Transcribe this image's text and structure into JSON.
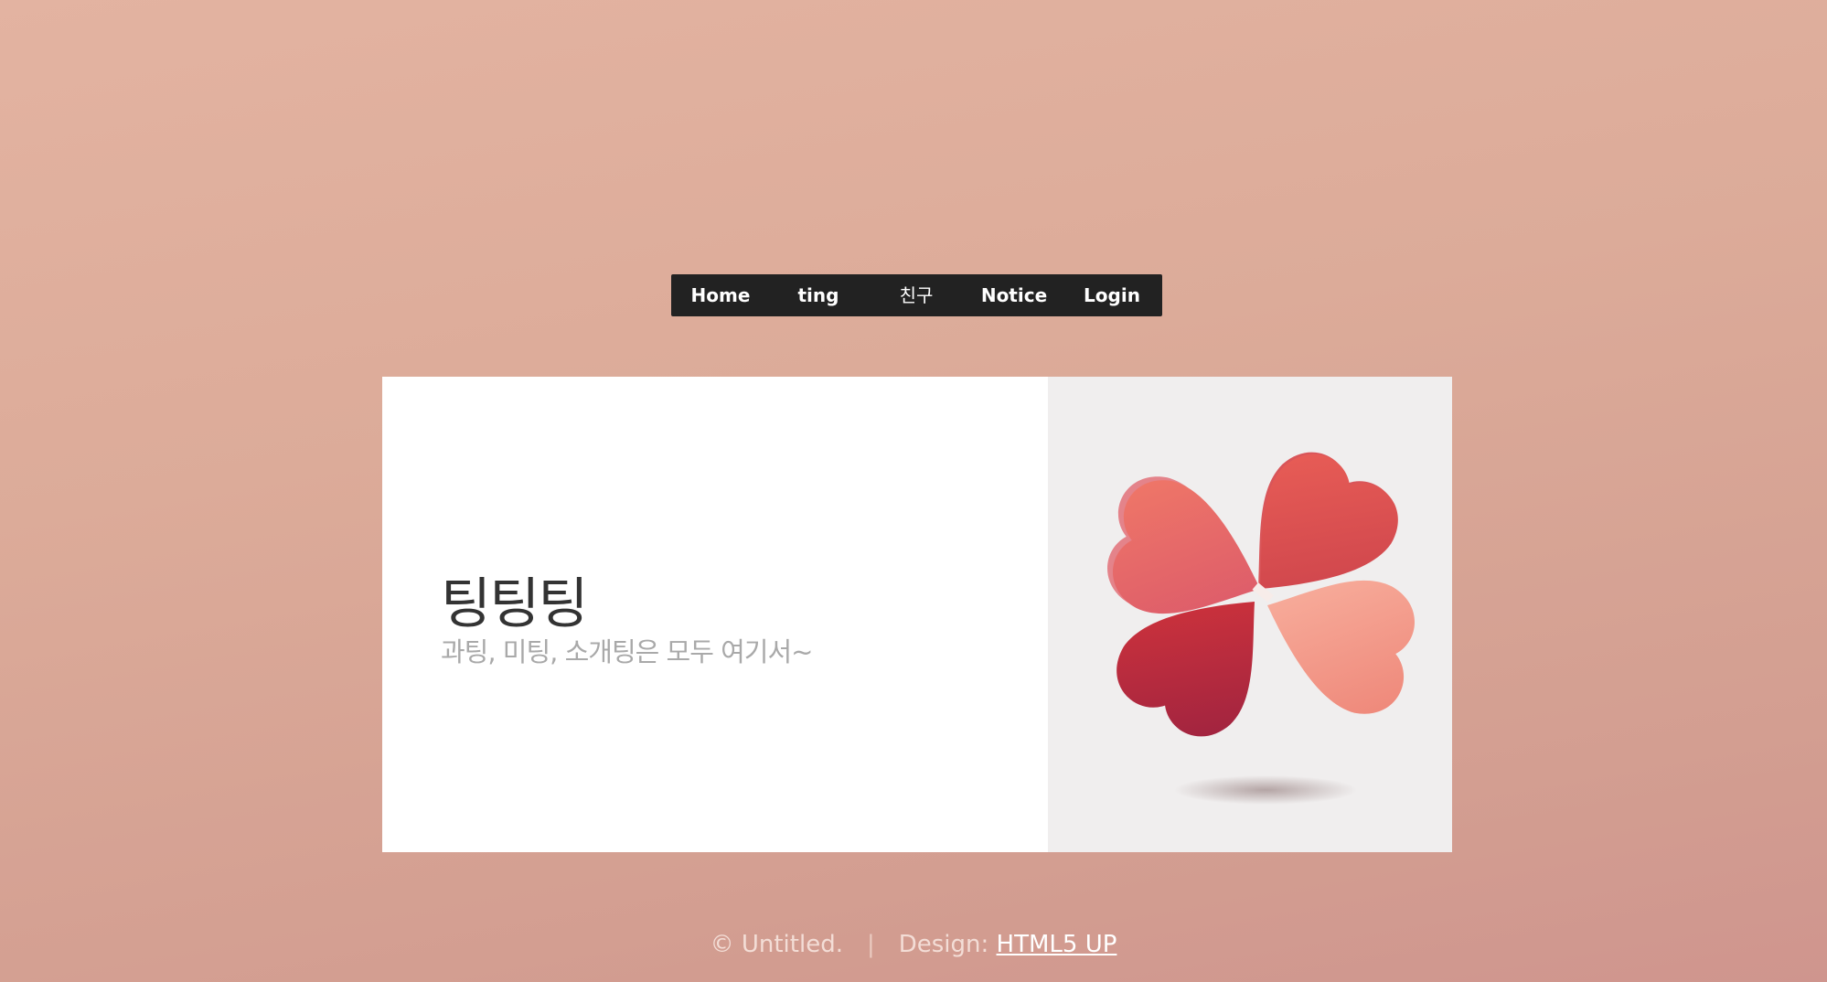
{
  "nav": {
    "items": [
      {
        "label": "Home"
      },
      {
        "label": "ting"
      },
      {
        "label": "친구"
      },
      {
        "label": "Notice"
      },
      {
        "label": "Login"
      }
    ]
  },
  "banner": {
    "title": "팅팅팅",
    "subtitle": "과팅, 미팅, 소개팅은 모두 여기서~",
    "image": "four-heart-clover-illustration"
  },
  "footer": {
    "copyright": "© Untitled.",
    "separator": "|",
    "design_label": "Design:",
    "design_link": "HTML5 UP"
  },
  "colors": {
    "background": "#dcab99",
    "nav_background": "#222222",
    "heart_red": "#d8474f",
    "heart_pink": "#f3a091"
  }
}
